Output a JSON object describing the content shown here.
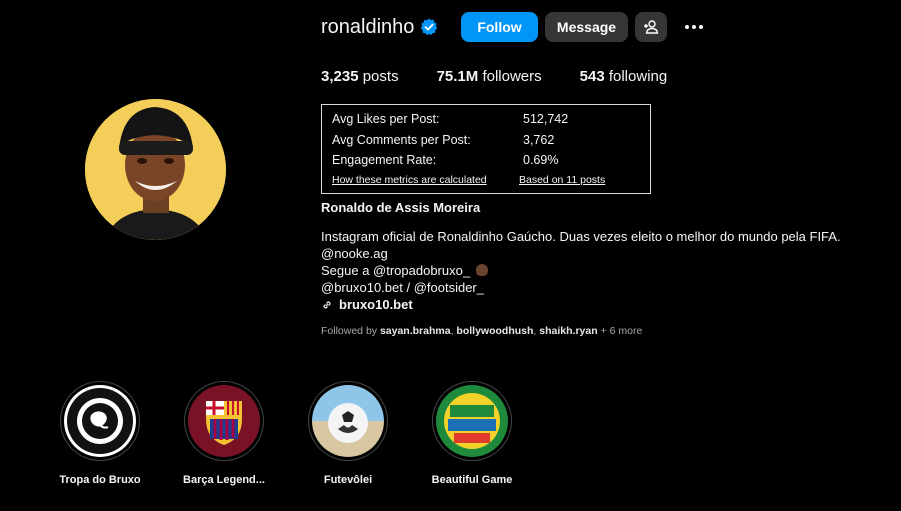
{
  "profile": {
    "username": "ronaldinho",
    "full_name": "Ronaldo de Assis Moreira",
    "verified_icon": "verified-badge-icon",
    "follow_label": "Follow",
    "message_label": "Message"
  },
  "stats": {
    "posts_count": "3,235",
    "posts_label": "posts",
    "followers_count": "75.1M",
    "followers_label": "followers",
    "following_count": "543",
    "following_label": "following"
  },
  "metrics": {
    "avg_likes_label": "Avg Likes per Post:",
    "avg_likes_value": "512,742",
    "avg_comments_label": "Avg Comments per Post:",
    "avg_comments_value": "3,762",
    "engagement_label": "Engagement Rate:",
    "engagement_value": "0.69%",
    "how_link": "How these metrics are calculated",
    "based_link": "Based on 11 posts"
  },
  "bio": {
    "line1": "Instagram oficial de Ronaldinho Gaúcho. Duas vezes eleito o melhor do mundo pela FIFA.",
    "line2": "@nooke.ag",
    "line3": "Segue a @tropadobruxo_ ",
    "line4": "@bruxo10.bet / @footsider_",
    "link": "bruxo10.bet"
  },
  "followed_by": {
    "prefix": "Followed by ",
    "user1": "sayan.brahma",
    "sep1": ", ",
    "user2": "bollywoodhush",
    "sep2": ", ",
    "user3": "shaikh.ryan",
    "suffix": " + 6 more"
  },
  "highlights": [
    {
      "label": "Tropa do Bruxo"
    },
    {
      "label": "Barça Legend..."
    },
    {
      "label": "Futevôlei"
    },
    {
      "label": "Beautiful Game"
    }
  ],
  "colors": {
    "background": "#000000",
    "follow_button": "#0095f6",
    "secondary_button": "#363636",
    "verified": "#0095f6",
    "avatar_bg": "#f3cf5a"
  }
}
